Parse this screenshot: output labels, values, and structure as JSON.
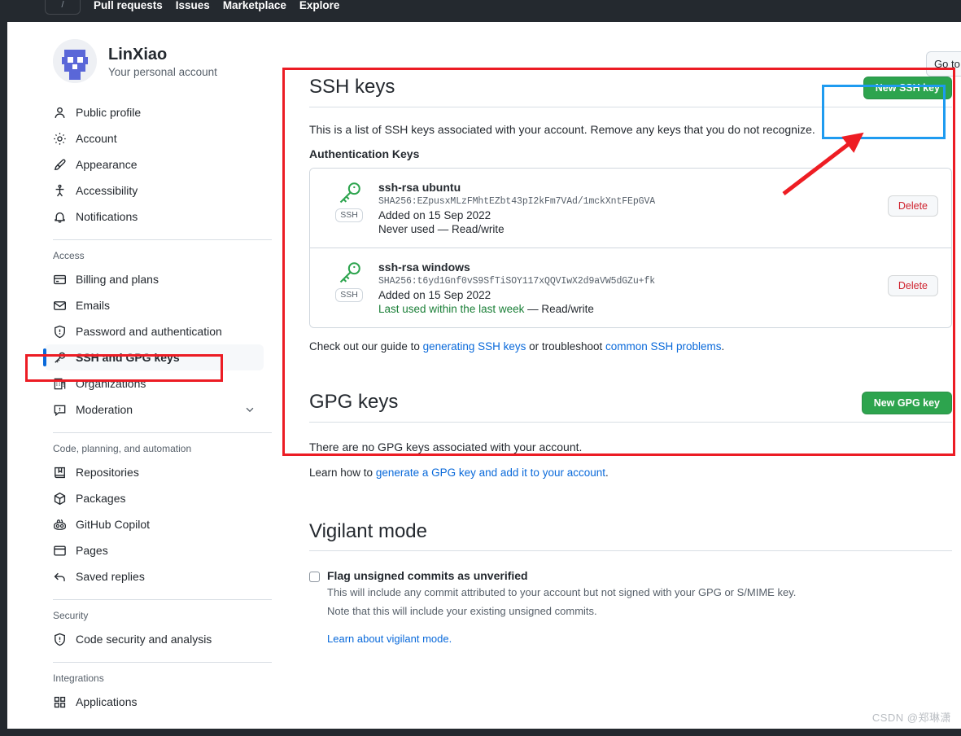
{
  "topnav": {
    "search_box": "/",
    "links": [
      "Pull requests",
      "Issues",
      "Marketplace",
      "Explore"
    ]
  },
  "goto_button": {
    "label": "Go to"
  },
  "account": {
    "name": "LinXiao",
    "subtitle": "Your personal account",
    "avatar_icon": "user-avatar"
  },
  "sidebar": {
    "groups": [
      {
        "heading": null,
        "items": [
          {
            "label": "Public profile",
            "icon": "person-icon",
            "active": false
          },
          {
            "label": "Account",
            "icon": "gear-icon",
            "active": false
          },
          {
            "label": "Appearance",
            "icon": "paintbrush-icon",
            "active": false
          },
          {
            "label": "Accessibility",
            "icon": "accessibility-icon",
            "active": false
          },
          {
            "label": "Notifications",
            "icon": "bell-icon",
            "active": false
          }
        ]
      },
      {
        "heading": "Access",
        "items": [
          {
            "label": "Billing and plans",
            "icon": "credit-card-icon",
            "active": false
          },
          {
            "label": "Emails",
            "icon": "mail-icon",
            "active": false
          },
          {
            "label": "Password and authentication",
            "icon": "shield-lock-icon",
            "active": false
          },
          {
            "label": "SSH and GPG keys",
            "icon": "key-icon",
            "active": true
          },
          {
            "label": "Organizations",
            "icon": "organization-icon",
            "active": false
          },
          {
            "label": "Moderation",
            "icon": "comment-icon",
            "active": false,
            "chevron": "chevron-down-icon"
          }
        ]
      },
      {
        "heading": "Code, planning, and automation",
        "items": [
          {
            "label": "Repositories",
            "icon": "repo-icon",
            "active": false
          },
          {
            "label": "Packages",
            "icon": "package-icon",
            "active": false
          },
          {
            "label": "GitHub Copilot",
            "icon": "copilot-icon",
            "active": false
          },
          {
            "label": "Pages",
            "icon": "browser-icon",
            "active": false
          },
          {
            "label": "Saved replies",
            "icon": "reply-icon",
            "active": false
          }
        ]
      },
      {
        "heading": "Security",
        "items": [
          {
            "label": "Code security and analysis",
            "icon": "shield-check-icon",
            "active": false
          }
        ]
      },
      {
        "heading": "Integrations",
        "items": [
          {
            "label": "Applications",
            "icon": "apps-grid-icon",
            "active": false
          }
        ]
      }
    ]
  },
  "ssh": {
    "title": "SSH keys",
    "new_key_button": "New SSH key",
    "description": "This is a list of SSH keys associated with your account. Remove any keys that you do not recognize.",
    "subheading": "Authentication Keys",
    "keys": [
      {
        "title": "ssh-rsa ubuntu",
        "fingerprint": "SHA256:EZpusxMLzFMhtEZbt43pI2kFm7VAd/1mckXntFEpGVA",
        "added": "Added on 15 Sep 2022",
        "usage": "Never used",
        "usage_tail": " — Read/write",
        "usage_recent": false,
        "badge": "SSH",
        "delete_label": "Delete"
      },
      {
        "title": "ssh-rsa windows",
        "fingerprint": "SHA256:t6yd1Gnf0vS9SfTiSOY117xQQVIwX2d9aVW5dGZu+fk",
        "added": "Added on 15 Sep 2022",
        "usage": "Last used within the last week",
        "usage_tail": " — Read/write",
        "usage_recent": true,
        "badge": "SSH",
        "delete_label": "Delete"
      }
    ],
    "guide_prefix": "Check out our guide to ",
    "guide_link1": "generating SSH keys",
    "guide_middle": " or troubleshoot ",
    "guide_link2": "common SSH problems",
    "guide_suffix": "."
  },
  "gpg": {
    "title": "GPG keys",
    "new_key_button": "New GPG key",
    "empty_text": "There are no GPG keys associated with your account.",
    "learn_prefix": "Learn how to ",
    "learn_link": "generate a GPG key and add it to your account",
    "learn_suffix": "."
  },
  "vigilant": {
    "title": "Vigilant mode",
    "checkbox_label": "Flag unsigned commits as unverified",
    "checkbox_checked": false,
    "note_line1": "This will include any commit attributed to your account but not signed with your GPG or S/MIME key.",
    "note_line2": "Note that this will include your existing unsigned commits.",
    "learn_link": "Learn about vigilant mode."
  },
  "annotations": {
    "red_color": "#ec1c24",
    "blue_color": "#1e9bf0",
    "arrow_color": "#ee1d23"
  },
  "watermark": "CSDN @郑琳潇"
}
